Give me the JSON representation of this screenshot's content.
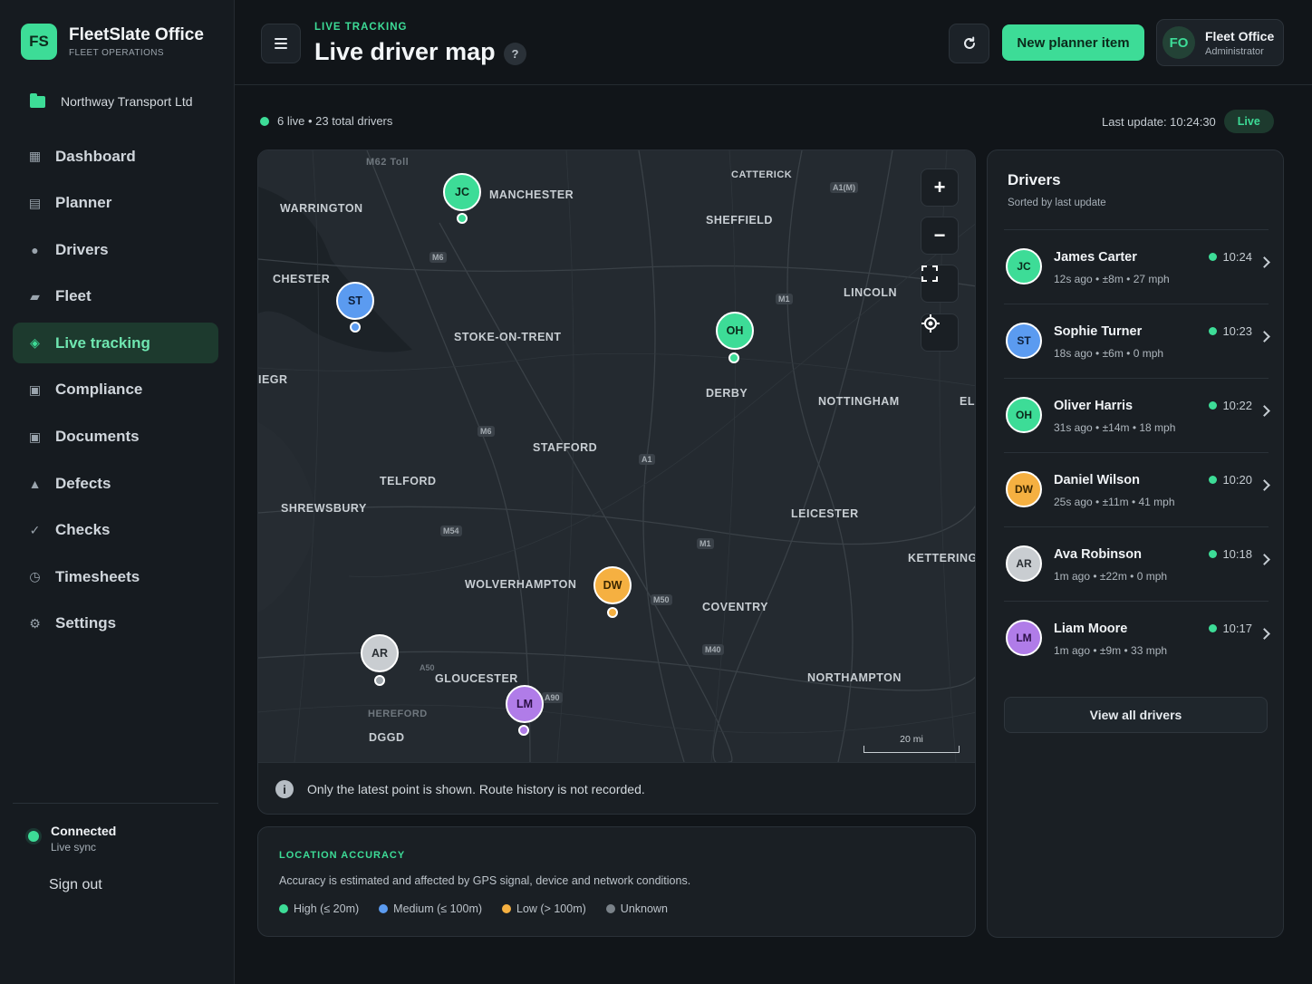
{
  "brand": {
    "logo": "FS",
    "name": "FleetSlate Office",
    "subtitle": "FLEET OPERATIONS"
  },
  "organization": {
    "name": "Northway Transport Ltd",
    "icon": "folder-icon"
  },
  "nav": [
    {
      "label": "Dashboard",
      "icon": "dashboard-icon",
      "glyph": "▦",
      "active": false
    },
    {
      "label": "Planner",
      "icon": "planner-icon",
      "glyph": "▤",
      "active": false
    },
    {
      "label": "Drivers",
      "icon": "user-icon",
      "glyph": "●",
      "active": false
    },
    {
      "label": "Fleet",
      "icon": "truck-icon",
      "glyph": "▰",
      "active": false
    },
    {
      "label": "Live tracking",
      "icon": "location-icon",
      "glyph": "◈",
      "active": true
    },
    {
      "label": "Compliance",
      "icon": "compliance-icon",
      "glyph": "▣",
      "active": false
    },
    {
      "label": "Documents",
      "icon": "document-icon",
      "glyph": "▣",
      "active": false
    },
    {
      "label": "Defects",
      "icon": "warning-icon",
      "glyph": "▲",
      "active": false
    },
    {
      "label": "Checks",
      "icon": "check-icon",
      "glyph": "✓",
      "active": false
    },
    {
      "label": "Timesheets",
      "icon": "clock-icon",
      "glyph": "◷",
      "active": false
    },
    {
      "label": "Settings",
      "icon": "gear-icon",
      "glyph": "⚙",
      "active": false
    }
  ],
  "connection": {
    "title": "Connected",
    "subtitle": "Live sync"
  },
  "sign_out": "Sign out",
  "header": {
    "eyebrow": "LIVE TRACKING",
    "title": "Live driver map",
    "help": "?",
    "new_button": "New planner item",
    "user": {
      "initials": "FO",
      "name": "Fleet Office",
      "role": "Administrator"
    }
  },
  "status": {
    "summary": "6 live • 23 total drivers",
    "last_update": "Last update: 10:24:30",
    "live_badge": "Live"
  },
  "map": {
    "cities": [
      "M62 Toll",
      "WARRINGTON",
      "MANCHESTER",
      "CATTERICK",
      "SHEFFIELD",
      "CHESTER",
      "LINCOLN",
      "STOKE-ON-TRENT",
      "DERBY",
      "NOTTINGHAM",
      "ELI",
      "IEGR",
      "STAFFORD",
      "TELFORD",
      "SHREWSBURY",
      "LEICESTER",
      "KETTERING",
      "WOLVERHAMPTON",
      "COVENTRY",
      "GLOUCESTER",
      "NORTHAMPTON",
      "HEREFORD",
      "DGGD"
    ],
    "roads": [
      "A1(M)",
      "M6",
      "M1",
      "M6",
      "A1",
      "M54",
      "M1",
      "M50",
      "M40",
      "A50",
      "A90"
    ],
    "zoom_in": "+",
    "zoom_out": "−",
    "scale": "20 mi",
    "note": "Only the latest point is shown. Route history is not recorded.",
    "markers": [
      {
        "initials": "JC",
        "accuracy": "high"
      },
      {
        "initials": "ST",
        "accuracy": "medium"
      },
      {
        "initials": "OH",
        "accuracy": "high"
      },
      {
        "initials": "DW",
        "accuracy": "low"
      },
      {
        "initials": "AR",
        "accuracy": "unknown"
      },
      {
        "initials": "LM",
        "accuracy": "purple"
      }
    ]
  },
  "accuracy": {
    "title": "LOCATION ACCURACY",
    "description": "Accuracy is estimated and affected by GPS signal, device and network conditions.",
    "legend": [
      {
        "label": "High (≤ 20m)",
        "color": "#3ddc97"
      },
      {
        "label": "Medium (≤ 100m)",
        "color": "#5b9bf0"
      },
      {
        "label": "Low (> 100m)",
        "color": "#f5b041"
      },
      {
        "label": "Unknown",
        "color": "#7a8289"
      }
    ]
  },
  "drivers": {
    "title": "Drivers",
    "subtitle": "Sorted by last update",
    "view_all": "View all drivers",
    "list": [
      {
        "initials": "JC",
        "name": "James Carter",
        "meta": "12s ago • ±8m • 27 mph",
        "time": "10:24",
        "color": "#3ddc97"
      },
      {
        "initials": "ST",
        "name": "Sophie Turner",
        "meta": "18s ago • ±6m • 0 mph",
        "time": "10:23",
        "color": "#5b9bf0"
      },
      {
        "initials": "OH",
        "name": "Oliver Harris",
        "meta": "31s ago • ±14m • 18 mph",
        "time": "10:22",
        "color": "#3ddc97"
      },
      {
        "initials": "DW",
        "name": "Daniel Wilson",
        "meta": "25s ago • ±11m • 41 mph",
        "time": "10:20",
        "color": "#f5b041"
      },
      {
        "initials": "AR",
        "name": "Ava Robinson",
        "meta": "1m ago • ±22m • 0 mph",
        "time": "10:18",
        "color": "#c9cdd1"
      },
      {
        "initials": "LM",
        "name": "Liam Moore",
        "meta": "1m ago • ±9m • 33 mph",
        "time": "10:17",
        "color": "#b07ce8"
      }
    ]
  },
  "colors": {
    "accent": "#3ddc97",
    "background": "#111519",
    "panel": "#1a1f24"
  }
}
